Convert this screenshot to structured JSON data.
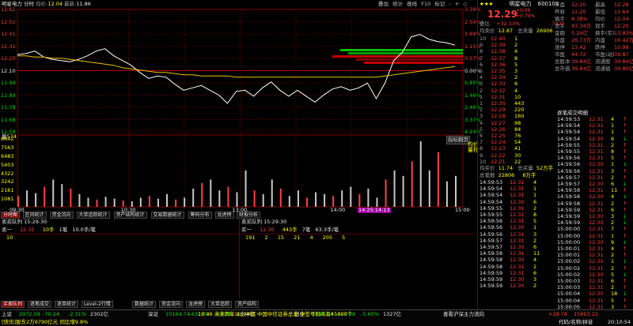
{
  "header": {
    "title": "明星电力 分时",
    "price_label": "均价:",
    "price": "12.04",
    "latest_label": "最新:",
    "latest": "11.86",
    "toolbar": [
      "叠加",
      "统计",
      "画线",
      "F10",
      "标记",
      "-",
      "+",
      "◇"
    ]
  },
  "y_axis_price": [
    "12.61",
    "12.51",
    "12.41",
    "12.31",
    "12.20",
    "12.10",
    "11.99",
    "11.89",
    "11.78",
    "11.68",
    "11.58"
  ],
  "y_axis_pct": [
    "3.39%",
    "2.54%",
    "1.69%",
    "1.15%",
    "0.57%",
    "0.00%",
    "0.85%",
    "1.46%",
    "2.46%",
    "3.37%",
    "4.24%"
  ],
  "volume": {
    "label": "量",
    "value": "574",
    "y_labels": [
      "8642",
      "7563",
      "6483",
      "5403",
      "4322",
      "3242",
      "2161",
      "1081"
    ],
    "y_labels_right": [
      "8642",
      "7563",
      "6483",
      "5403",
      "4322",
      "3242",
      "2161",
      "1081"
    ],
    "flag": "指标翻页",
    "side_label": "均价\n量柱"
  },
  "time_axis": [
    "09:30",
    "10:30",
    "13:00",
    "14:00",
    "14:25",
    "14:27",
    "15:00"
  ],
  "highlight_time": "14:25:14:13",
  "chart_data": {
    "type": "line",
    "series": [
      {
        "name": "",
        "values": [
          12.23,
          12.24,
          12.26,
          12.21,
          12.19,
          12.18,
          12.17,
          12.19,
          12.22,
          12.26,
          12.28,
          12.22,
          12.18,
          12.14,
          12.08,
          12.03,
          12.05,
          12.04,
          11.98,
          11.93,
          11.95,
          11.97,
          11.93,
          11.89,
          11.82,
          11.92,
          11.93,
          11.88,
          11.95,
          12.0,
          11.93,
          11.88,
          11.93,
          11.88,
          11.83,
          11.89,
          11.94,
          11.96,
          11.93,
          11.95,
          11.99,
          11.86,
          11.99,
          12.18,
          12.25,
          12.38,
          12.4,
          12.36,
          12.34,
          12.33,
          12.31
        ]
      },
      {
        "name": "",
        "values": [
          12.22,
          12.22,
          12.21,
          12.21,
          12.2,
          12.2,
          12.19,
          12.18,
          12.17,
          12.16,
          12.15,
          12.14,
          12.12,
          12.11,
          12.1,
          12.09,
          12.08,
          12.08,
          12.07,
          12.06,
          12.06,
          12.05,
          12.05,
          12.05,
          12.05,
          12.04,
          12.04,
          12.04,
          12.04,
          12.04,
          12.04,
          12.04,
          12.04,
          12.04,
          12.04,
          12.04,
          12.04,
          12.04,
          12.04,
          12.04,
          12.04,
          12.04,
          12.05,
          12.06,
          12.07,
          12.08,
          12.09,
          12.1,
          12.11,
          12.12,
          12.13
        ]
      }
    ],
    "volume": [
      12,
      18,
      15,
      22,
      30,
      25,
      20,
      14,
      10,
      8,
      11,
      9,
      7,
      6,
      10,
      12,
      9,
      14,
      8,
      10,
      20,
      26,
      30,
      18,
      22,
      16,
      40,
      18,
      14,
      30,
      20,
      12,
      18,
      10,
      16,
      14,
      12,
      18,
      22,
      14,
      20,
      10,
      30,
      40,
      34,
      50,
      72,
      40,
      60,
      28,
      34
    ],
    "ylim": [
      11.58,
      12.61
    ]
  },
  "order_queue": {
    "sell_title": "卖买队列",
    "sell_time": "15:29:30",
    "sell_row": [
      "卖一",
      "12.31",
      "10手",
      "1笔",
      "10.0手/笔"
    ],
    "sell_vals": [
      "10"
    ],
    "buy_title": "卖买队列",
    "buy_time": "15:29:30",
    "buy_row": [
      "买一",
      "12.30",
      "443手",
      "7笔",
      "63.3手/笔"
    ],
    "buy_vals": [
      "191",
      "2",
      "15",
      "21",
      "4",
      "205",
      "5"
    ]
  },
  "tabs": [
    "分时图",
    "区间统计",
    "资金流向",
    "大单追踪统计",
    "资产结构统计",
    "交易数据统计",
    "筹码分布",
    "龙虎榜",
    "财报分析"
  ],
  "bottom_tabs": [
    "买卖队列",
    "逐笔成交",
    "逐单统计",
    "Level-2行情",
    "数据统计",
    "资金流向",
    "龙虎榜",
    "大单追踪",
    "资产结构"
  ],
  "quote": {
    "stars": "★★★",
    "name": "明星电力",
    "code": "600101",
    "price": "12.29",
    "change": "+0.09",
    "change_pct": "+0.74%",
    "fields": [
      [
        "开盘",
        "12.20",
        "最高",
        "12.28"
      ],
      [
        "昨收",
        "12.20",
        "最低",
        "11.64"
      ],
      [
        "换手",
        "6.38%",
        "均价",
        "12.04"
      ],
      [
        "总手",
        "43.34万",
        "现手",
        "12.20"
      ],
      [
        "金额",
        "5.24亿",
        "换手(实)",
        "13.83%"
      ],
      [
        "外盘",
        "26.73万",
        "内盘",
        "16.42万"
      ],
      [
        "涨停",
        "13.42",
        "跌停",
        "10.98"
      ],
      [
        "市盈",
        "44.72",
        "市盈(动)",
        "39.87"
      ],
      [
        "总股本",
        "39.84亿",
        "流通股",
        "39.84亿"
      ],
      [
        "总市值",
        "39.84亿",
        "流通值",
        "39.80亿"
      ]
    ],
    "weibi_label": "委比",
    "weibi": "+32.13%",
    "weicha": "7421",
    "jjj_label": "均卖价",
    "jjj": "12.87",
    "zml_label": "总卖量",
    "zml": "26906",
    "sell_levels": [
      [
        "12.40",
        "1"
      ],
      [
        "12.39",
        "2"
      ],
      [
        "12.38",
        "4"
      ],
      [
        "12.37",
        "8"
      ],
      [
        "12.36",
        "5"
      ],
      [
        "12.35",
        "3"
      ],
      [
        "12.34",
        "2"
      ],
      [
        "12.33",
        "6"
      ],
      [
        "12.32",
        "4"
      ],
      [
        "12.31",
        "10"
      ]
    ],
    "buy_levels": [
      [
        "12.30",
        "443"
      ],
      [
        "12.29",
        "220"
      ],
      [
        "12.28",
        "160"
      ],
      [
        "12.27",
        "98"
      ],
      [
        "12.26",
        "84"
      ],
      [
        "12.25",
        "76"
      ],
      [
        "12.24",
        "54"
      ],
      [
        "12.23",
        "41"
      ],
      [
        "12.22",
        "30"
      ],
      [
        "12.21",
        "22"
      ]
    ],
    "jmj_label": "均买价",
    "jmj": "11.74",
    "zml2_label": "总买量",
    "zml2": "52万手",
    "bishu_label": "总笔数",
    "bishu": "22806",
    "bishu2": "8万手"
  },
  "trades_title": "逐笔成交明细",
  "trades": [
    [
      "14:59:53",
      "12.31",
      "4",
      "↑"
    ],
    [
      "14:59:54",
      "12.31",
      "1",
      "↑"
    ],
    [
      "14:59:54",
      "12.31",
      "1",
      "↑"
    ],
    [
      "14:59:54",
      "12.30",
      "6",
      "↓"
    ],
    [
      "14:59:55",
      "12.31",
      "2",
      "↑"
    ],
    [
      "14:59:55",
      "12.31",
      "8",
      "↑"
    ],
    [
      "14:59:56",
      "12.31",
      "5",
      "↑"
    ],
    [
      "14:59:56",
      "12.30",
      "1",
      "↓"
    ],
    [
      "14:59:56",
      "12.31",
      "3",
      "↑"
    ],
    [
      "14:59:57",
      "12.31",
      "2",
      "↑"
    ],
    [
      "14:59:57",
      "12.30",
      "6",
      "↓"
    ],
    [
      "14:59:58",
      "12.31",
      "11",
      "↑"
    ],
    [
      "14:59:58",
      "12.30",
      "4",
      "↓"
    ],
    [
      "14:59:58",
      "12.31",
      "2",
      "↑"
    ],
    [
      "14:59:59",
      "12.31",
      "6",
      "↑"
    ],
    [
      "14:59:59",
      "12.30",
      "3",
      "↓"
    ],
    [
      "14:59:59",
      "12.30",
      "2",
      "↓"
    ],
    [
      "15:00:00",
      "12.31",
      "7",
      "↑"
    ],
    [
      "15:00:00",
      "12.31",
      "1",
      "↑"
    ],
    [
      "15:00:00",
      "12.30",
      "9",
      "↓"
    ],
    [
      "15:00:01",
      "12.31",
      "4",
      "↑"
    ],
    [
      "15:00:01",
      "12.31",
      "2",
      "↑"
    ],
    [
      "15:00:02",
      "12.30",
      "1",
      "↓"
    ],
    [
      "15:00:02",
      "12.31",
      "2",
      "↑"
    ],
    [
      "15:00:02",
      "12.30",
      "5",
      "↓"
    ],
    [
      "15:00:03",
      "12.31",
      "6",
      "↑"
    ],
    [
      "15:00:03",
      "12.31",
      "2",
      "↑"
    ],
    [
      "15:00:04",
      "12.30",
      "18",
      "↓"
    ],
    [
      "15:00:04",
      "12.31",
      "5",
      "↑"
    ],
    [
      "15:00:05",
      "12.31",
      "3",
      "↑"
    ]
  ],
  "status": {
    "line1": [
      [
        "上证",
        "2972.58",
        "-70.24",
        "-2.31%",
        "2302亿"
      ],
      [
        "深证",
        "10164.74",
        "-437.72",
        "-4.13%",
        "4894亿"
      ],
      [
        "创业",
        "2145.24",
        "-127.28",
        "-5.60%",
        "1327亿"
      ]
    ],
    "ticker": "18:46 未来四年以上中期 中国中信证券总发 中签号码共有45000个",
    "right": "查看沪深主力流向",
    "marquee": "[快讯]股东2万9790亿元 同比增9.8%",
    "clock": "20:10:54",
    "extra": [
      "+28.78",
      "15693.22",
      "代码/名称/拼音"
    ]
  }
}
